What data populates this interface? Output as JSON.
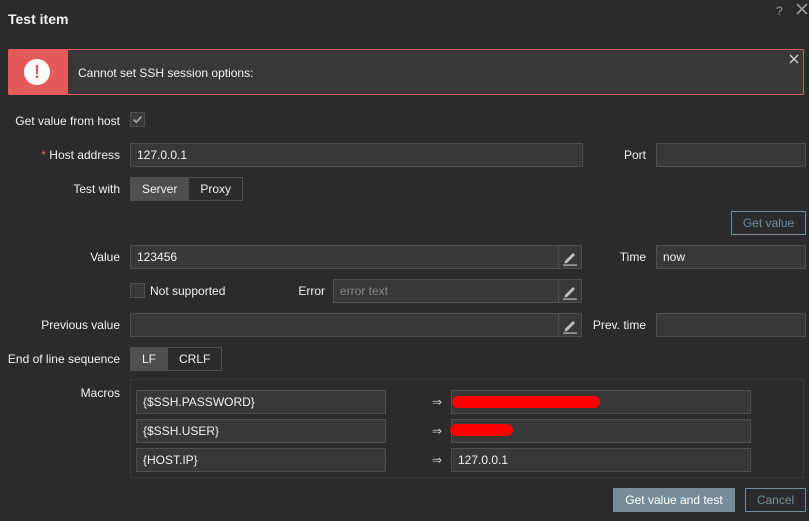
{
  "dialog": {
    "title": "Test item",
    "help_symbol": "?"
  },
  "alert": {
    "message": "Cannot set SSH session options:",
    "icon_symbol": "!"
  },
  "form": {
    "get_value_from_host_label": "Get value from host",
    "get_value_from_host_checked": true,
    "host_address_label": "Host address",
    "host_address_required_mark": "*",
    "host_address_value": "127.0.0.1",
    "port_label": "Port",
    "port_value": "",
    "test_with_label": "Test with",
    "test_with_options": [
      "Server",
      "Proxy"
    ],
    "test_with_selected": "Server",
    "get_value_button": "Get value",
    "value_label": "Value",
    "value_value": "123456",
    "time_label": "Time",
    "time_value": "now",
    "not_supported_label": "Not supported",
    "not_supported_checked": false,
    "error_label": "Error",
    "error_placeholder": "error text",
    "previous_value_label": "Previous value",
    "previous_value_value": "",
    "prev_time_label": "Prev. time",
    "prev_time_value": "",
    "eol_label": "End of line sequence",
    "eol_options": [
      "LF",
      "CRLF"
    ],
    "eol_selected": "LF",
    "macros_label": "Macros",
    "macro_arrow": "⇒",
    "macros": [
      {
        "name": "{$SSH.PASSWORD}",
        "value": "",
        "redacted": true
      },
      {
        "name": "{$SSH.USER}",
        "value": "",
        "redacted": true
      },
      {
        "name": "{HOST.IP}",
        "value": "127.0.0.1",
        "redacted": false
      }
    ]
  },
  "footer": {
    "submit_button": "Get value and test",
    "cancel_button": "Cancel"
  },
  "colors": {
    "background": "#2b2b2b",
    "field": "#383838",
    "border": "#4f4f4f",
    "error": "#e45959",
    "accent": "#768d99",
    "redaction": "#ff0000"
  }
}
